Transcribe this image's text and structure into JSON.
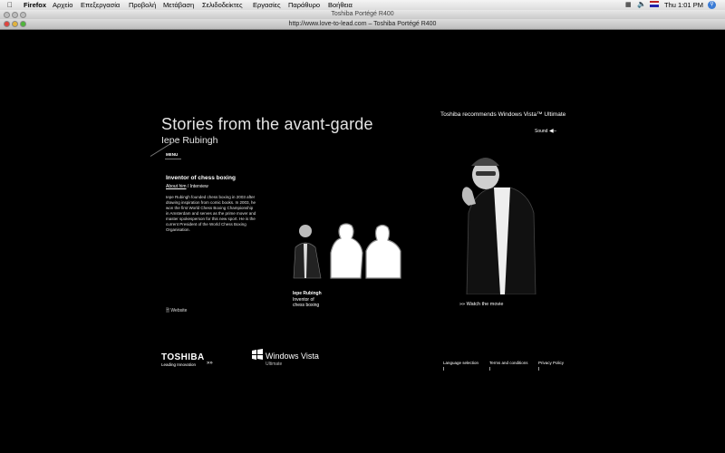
{
  "menubar": {
    "items": [
      "Firefox",
      "Αρχείο",
      "Επεξεργασία",
      "Προβολή",
      "Μετάβαση",
      "Σελιδοδείκτες",
      "Εργασίες",
      "Παράθυρο",
      "Βοήθεια"
    ],
    "clock": "Thu 1:01 PM"
  },
  "window": {
    "title": "Toshiba Portégé R400",
    "url_title": "http://www.love-to-lead.com – Toshiba Portégé R400"
  },
  "page": {
    "headline": "Stories from the avant-garde",
    "person": "Iepe Rubingh",
    "menu_label": "MENU",
    "section_title": "Inventor of chess boxing",
    "about_link": "About him",
    "separator": " / ",
    "interview_link": "Interview",
    "bio": "Iepe Rubingh founded chess boxing in 2003 after drawing inspiration from comic books. In 2003, he won the first World Chess Boxing Championship in Amsterdam and serves as the prime mover and master spokesperson for this new sport. He is the current President of the World Chess Boxing Organisation.",
    "website_link": "Website",
    "recommend": "Toshiba recommends Windows Vista™ Ultimate",
    "sound_label": "Sound",
    "thumb_name": "Iepe Rubingh",
    "thumb_role_1": "Inventor of",
    "thumb_role_2": "chess boxing",
    "watch_movie": "Watch the movie",
    "arrows": "»»",
    "toshiba_logo": "TOSHIBA",
    "toshiba_tag": "Leading Innovation",
    "windows_logo": "Windows Vista",
    "windows_edition": "Ultimate",
    "footer_links": [
      "Language selection",
      "Terms and conditions",
      "Privacy Policy"
    ]
  }
}
